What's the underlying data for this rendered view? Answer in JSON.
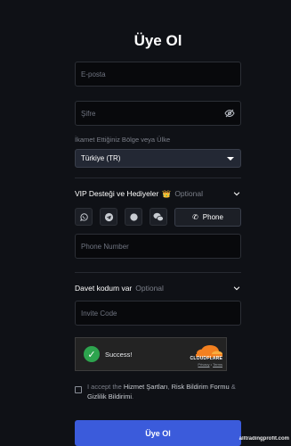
{
  "page": {
    "title": "Üye Ol"
  },
  "form": {
    "email_placeholder": "E-posta",
    "password_placeholder": "Şifre",
    "country_label": "İkamet Ettiğiniz Bölge veya Ülke",
    "country_value": "Türkiye (TR)",
    "vip": {
      "title": "VIP Desteği ve Hediyeler",
      "crown_icon": "👑",
      "optional": "Optional",
      "icons": [
        "whatsapp-icon",
        "telegram-icon",
        "signal-icon",
        "wechat-icon"
      ],
      "phone_button": "Phone",
      "phone_placeholder": "Phone Number"
    },
    "invite": {
      "title": "Davet kodum var",
      "optional": "Optional",
      "placeholder": "Invite Code"
    },
    "captcha": {
      "status": "Success!",
      "brand": "CLOUDFLARE",
      "privacy": "Privacy",
      "separator": "•",
      "terms": "Terms"
    },
    "terms": {
      "prefix": "I accept the ",
      "link1": "Hizmet Şartları",
      "comma": ", ",
      "link2": "Risk Bildirim Formu",
      "amp": " & ",
      "link3": "Gizlilik Bildirimi",
      "suffix": "."
    },
    "submit_label": "Üye Ol"
  },
  "watermark": "alltradingprofit.com",
  "colors": {
    "background": "#0f1116",
    "accent": "#3b5bdb",
    "success": "#2da44e",
    "cloudflare_orange": "#f38020"
  }
}
